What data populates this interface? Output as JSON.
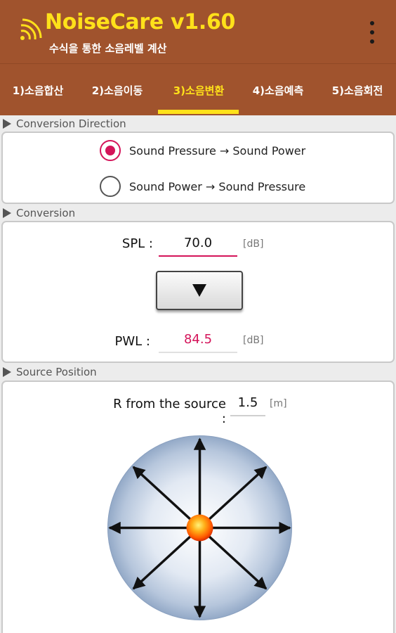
{
  "app": {
    "title": "NoiseCare v1.60",
    "subtitle": "수식을 통한 소음레벨 계산",
    "logo_icon": "sound-wave-icon",
    "menu_icon": "more-vert-icon"
  },
  "tabs": [
    {
      "label": "1)소음합산",
      "active": false
    },
    {
      "label": "2)소음이동",
      "active": false
    },
    {
      "label": "3)소음변환",
      "active": true
    },
    {
      "label": "4)소음예측",
      "active": false
    },
    {
      "label": "5)소음회전",
      "active": false
    }
  ],
  "sections": {
    "direction": "Conversion Direction",
    "conversion": "Conversion",
    "source": "Source Position"
  },
  "direction_options": [
    {
      "label": "Sound Pressure → Sound Power",
      "selected": true
    },
    {
      "label": "Sound Power → Sound Pressure",
      "selected": false
    }
  ],
  "conversion": {
    "spl_label": "SPL :",
    "spl_value": "70.0",
    "spl_unit": "[dB]",
    "button_icon": "arrow-down-icon",
    "pwl_label": "PWL :",
    "pwl_value": "84.5",
    "pwl_unit": "[dB]"
  },
  "source": {
    "r_label": "R from the source :",
    "r_value": "1.5",
    "r_unit": "[m]",
    "diagram_icon": "radiating-source-icon"
  },
  "colors": {
    "appbar": "#a0532d",
    "accent_yellow": "#ffe11a",
    "accent_pink": "#d4145a"
  }
}
